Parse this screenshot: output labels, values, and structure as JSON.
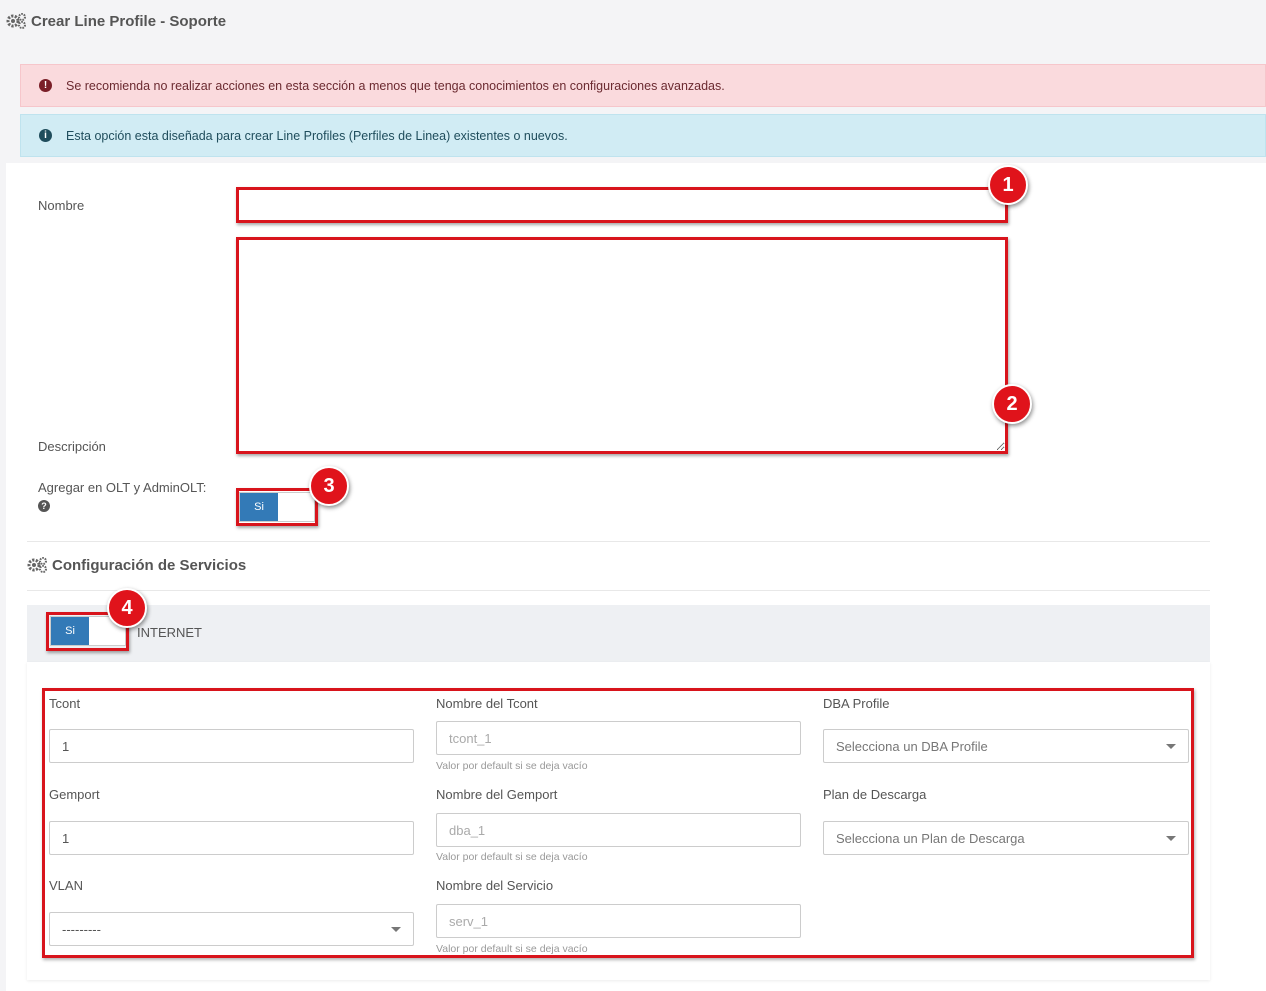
{
  "header": {
    "title": "Crear Line Profile - Soporte",
    "icon": "gears-icon"
  },
  "alerts": {
    "danger": {
      "icon": "exclamation-circle-icon",
      "text": "Se recomienda no realizar acciones en esta sección a menos que tenga conocimientos en configuraciones avanzadas."
    },
    "info": {
      "icon": "info-circle-icon",
      "text": "Esta opción esta diseñada para crear Line Profiles (Perfiles de Linea) existentes o nuevos."
    }
  },
  "form": {
    "nombre_label": "Nombre",
    "nombre_value": "",
    "descripcion_label": "Descripción",
    "descripcion_value": "",
    "agregar_label": "Agregar en OLT y AdminOLT:",
    "agregar_help_icon": "question-circle-icon",
    "agregar_toggle": "Si"
  },
  "services": {
    "title": "Configuración de Servicios",
    "icon": "gears-icon",
    "internet_toggle": "Si",
    "internet_label": "INTERNET",
    "tcont_label": "Tcont",
    "tcont_value": "1",
    "nombre_tcont_label": "Nombre del Tcont",
    "nombre_tcont_placeholder": "tcont_1",
    "nombre_tcont_help": "Valor por default si se deja vacío",
    "dba_label": "DBA Profile",
    "dba_value": "Selecciona un DBA Profile",
    "gemport_label": "Gemport",
    "gemport_value": "1",
    "nombre_gemport_label": "Nombre del Gemport",
    "nombre_gemport_placeholder": "dba_1",
    "nombre_gemport_help": "Valor por default si se deja vacío",
    "plan_label": "Plan de Descarga",
    "plan_value": "Selecciona un Plan de Descarga",
    "vlan_label": "VLAN",
    "vlan_value": "---------",
    "nombre_servicio_label": "Nombre del Servicio",
    "nombre_servicio_placeholder": "serv_1",
    "nombre_servicio_help": "Valor por default si se deja vacío"
  },
  "annotations": {
    "badge_1": "1",
    "badge_2": "2",
    "badge_3": "3",
    "badge_4": "4",
    "color": "#d8141c"
  }
}
